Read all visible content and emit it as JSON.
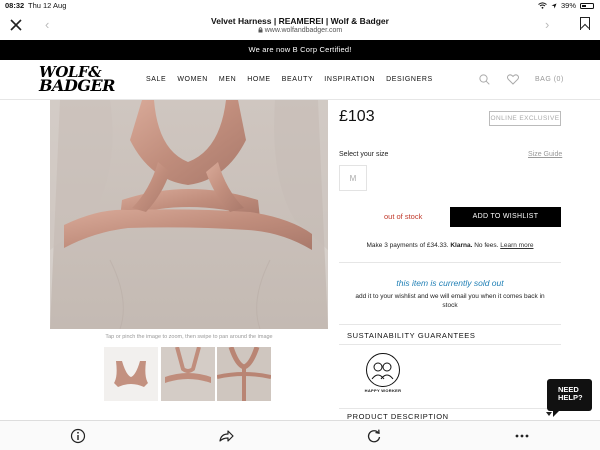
{
  "status_bar": {
    "time": "08:32",
    "date": "Thu 12 Aug",
    "battery": "39%"
  },
  "browser": {
    "title": "Velvet Harness | REAMEREI | Wolf & Badger",
    "url": "www.wolfandbadger.com"
  },
  "announcement": "We are now B Corp Certified!",
  "header": {
    "logo_line1": "WOLF&",
    "logo_line2": "BADGER",
    "nav": [
      "SALE",
      "WOMEN",
      "MEN",
      "HOME",
      "BEAUTY",
      "INSPIRATION",
      "DESIGNERS"
    ],
    "bag_label": "BAG (0)"
  },
  "product": {
    "image_hint": "Tap or pinch the image to zoom, then swipe to pan around the image",
    "price": "£103",
    "badge": "ONLINE EXCLUSIVE",
    "select_size_label": "Select your size",
    "size_guide_label": "Size Guide",
    "sizes": [
      "M"
    ],
    "stock_status": "out of stock",
    "wishlist_button": "ADD TO WISHLIST",
    "klarna_prefix": "Make 3 payments of £34.33.",
    "klarna_brand": "Klarna.",
    "klarna_suffix": "No fees.",
    "klarna_link": "Learn more",
    "soldout_title": "this item is currently sold out",
    "soldout_message": "add it to your wishlist and we will email you when it comes back in stock",
    "sustainability_heading": "SUSTAINABILITY GUARANTEES",
    "sustainability_badge": "HAPPY WORKER",
    "description_heading": "PRODUCT DESCRIPTION"
  },
  "help_widget": {
    "line1": "NEED",
    "line2": "HELP?"
  },
  "colors": {
    "accent_black": "#000000",
    "sold_out_blue": "#1f7fb5",
    "out_of_stock_red": "#c0392b",
    "velvet_pink": "#c99a8a"
  },
  "icons": {
    "browser": [
      "close-icon",
      "back-arrow-icon",
      "forward-arrow-icon",
      "bookmark-icon"
    ],
    "header": [
      "search-icon",
      "heart-icon"
    ],
    "toolbar": [
      "info-icon",
      "share-icon",
      "reload-icon",
      "more-icon"
    ]
  }
}
